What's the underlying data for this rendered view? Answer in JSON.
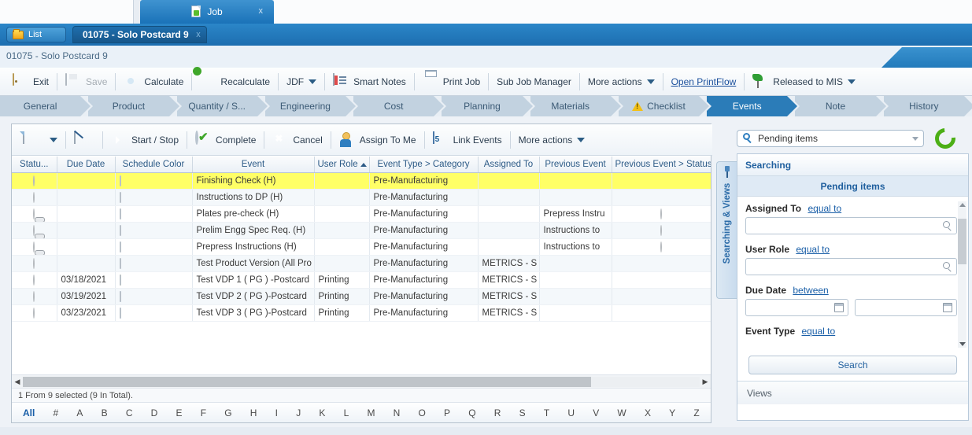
{
  "window": {
    "app_tab_label": "Job",
    "app_tab_close": "x",
    "app_tab_icon": "job-document-icon"
  },
  "header": {
    "list_button": "List",
    "record_tab": "01075 -   Solo Postcard 9",
    "record_tab_close": "x",
    "breadcrumb": "01075 - Solo Postcard 9"
  },
  "toolbar": {
    "items": [
      {
        "label": "Exit",
        "icon": "exit-door-icon",
        "disabled": false
      },
      {
        "label": "Save",
        "icon": "save-disk-icon",
        "disabled": true
      },
      {
        "label": "Calculate",
        "icon": "gear-icon",
        "disabled": false
      },
      {
        "label": "Recalculate",
        "icon": "gear-refresh-icon",
        "disabled": false
      },
      {
        "label": "JDF",
        "icon": "chevron-down-icon",
        "disabled": false
      },
      {
        "label": "Smart Notes",
        "icon": "smart-notes-icon",
        "disabled": false
      },
      {
        "label": "Print Job",
        "icon": "printer-icon",
        "disabled": false
      },
      {
        "label": "Sub Job Manager",
        "icon": "",
        "disabled": false
      },
      {
        "label": "More actions",
        "icon": "chevron-down-icon",
        "disabled": false
      },
      {
        "label": "Open PrintFlow",
        "icon": "",
        "disabled": false
      },
      {
        "label": "Released to MIS",
        "icon": "green-flag-icon",
        "disabled": false
      }
    ]
  },
  "ribbon": {
    "tabs": [
      {
        "label": "General",
        "active": false,
        "warn": false
      },
      {
        "label": "Product",
        "active": false,
        "warn": false
      },
      {
        "label": "Quantity / S...",
        "active": false,
        "warn": false
      },
      {
        "label": "Engineering",
        "active": false,
        "warn": false
      },
      {
        "label": "Cost",
        "active": false,
        "warn": false
      },
      {
        "label": "Planning",
        "active": false,
        "warn": false
      },
      {
        "label": "Materials",
        "active": false,
        "warn": false
      },
      {
        "label": "Checklist",
        "active": false,
        "warn": true
      },
      {
        "label": "Events",
        "active": true,
        "warn": false
      },
      {
        "label": "Note",
        "active": false,
        "warn": false
      },
      {
        "label": "History",
        "active": false,
        "warn": false
      }
    ]
  },
  "grid_toolbar": {
    "items": [
      {
        "label": "",
        "icon": "new-document-icon"
      },
      {
        "label": "",
        "icon": "chevron-down-icon"
      },
      {
        "label": "",
        "icon": "edit-document-icon"
      },
      {
        "label": "Start / Stop",
        "icon": "start-stop-icon"
      },
      {
        "label": "Complete",
        "icon": "check-circle-icon"
      },
      {
        "label": "Cancel",
        "icon": "cancel-circle-icon"
      },
      {
        "label": "Assign To Me",
        "icon": "user-icon"
      },
      {
        "label": "Link Events",
        "icon": "calendar-icon"
      },
      {
        "label": "More actions",
        "icon": "chevron-down-icon"
      }
    ]
  },
  "grid": {
    "columns": [
      {
        "label": "Statu...",
        "sorted": false
      },
      {
        "label": "Due Date",
        "sorted": false
      },
      {
        "label": "Schedule Color",
        "sorted": false
      },
      {
        "label": "Event",
        "sorted": false
      },
      {
        "label": "User Role",
        "sorted": true
      },
      {
        "label": "Event Type > Category",
        "sorted": false
      },
      {
        "label": "Assigned To",
        "sorted": false
      },
      {
        "label": "Previous Event",
        "sorted": false
      },
      {
        "label": "Previous Event > Status",
        "sorted": false
      }
    ],
    "rows": [
      {
        "status": "pending",
        "linked": false,
        "due_date": "",
        "color": "white",
        "event": "Finishing Check (H)",
        "user_role": "",
        "event_type": "Pre-Manufacturing",
        "assigned_to": "",
        "previous_event": "",
        "prev_status": "",
        "selected": true
      },
      {
        "status": "pending",
        "linked": false,
        "due_date": "",
        "color": "white",
        "event": "Instructions to DP (H)",
        "user_role": "",
        "event_type": "Pre-Manufacturing",
        "assigned_to": "",
        "previous_event": "",
        "prev_status": "",
        "selected": false
      },
      {
        "status": "pending",
        "linked": true,
        "due_date": "",
        "color": "white",
        "event": "Plates pre-check (H)",
        "user_role": "",
        "event_type": "Pre-Manufacturing",
        "assigned_to": "",
        "previous_event": "Prepress Instru",
        "prev_status": "pending",
        "selected": false
      },
      {
        "status": "pending",
        "linked": true,
        "due_date": "",
        "color": "white",
        "event": "Prelim Engg Spec Req. (H)",
        "user_role": "",
        "event_type": "Pre-Manufacturing",
        "assigned_to": "",
        "previous_event": "Instructions to",
        "prev_status": "pending",
        "selected": false
      },
      {
        "status": "pending",
        "linked": true,
        "due_date": "",
        "color": "white",
        "event": "Prepress Instructions (H)",
        "user_role": "",
        "event_type": "Pre-Manufacturing",
        "assigned_to": "",
        "previous_event": "Instructions to",
        "prev_status": "pending",
        "selected": false
      },
      {
        "status": "pending",
        "linked": false,
        "due_date": "",
        "color": "white",
        "event": "Test Product Version (All Pro",
        "user_role": "",
        "event_type": "Pre-Manufacturing",
        "assigned_to": "METRICS - S",
        "previous_event": "",
        "prev_status": "",
        "selected": false
      },
      {
        "status": "pending",
        "linked": false,
        "due_date": "03/18/2021",
        "color": "yellow",
        "event": "Test VDP 1 ( PG ) -Postcard",
        "user_role": "Printing",
        "event_type": "Pre-Manufacturing",
        "assigned_to": "METRICS - S",
        "previous_event": "",
        "prev_status": "",
        "selected": false
      },
      {
        "status": "pending",
        "linked": false,
        "due_date": "03/19/2021",
        "color": "blue",
        "event": "Test VDP 2 ( PG )-Postcard",
        "user_role": "Printing",
        "event_type": "Pre-Manufacturing",
        "assigned_to": "METRICS - S",
        "previous_event": "",
        "prev_status": "",
        "selected": false
      },
      {
        "status": "pending",
        "linked": false,
        "due_date": "03/23/2021",
        "color": "blue",
        "event": "Test VDP 3 ( PG  )-Postcard",
        "user_role": "Printing",
        "event_type": "Pre-Manufacturing",
        "assigned_to": "METRICS - S",
        "previous_event": "",
        "prev_status": "",
        "selected": false
      }
    ],
    "status_text": "1 From 9 selected (9 In Total).",
    "alphabet": [
      "All",
      "#",
      "A",
      "B",
      "C",
      "D",
      "E",
      "F",
      "G",
      "H",
      "I",
      "J",
      "K",
      "L",
      "M",
      "N",
      "O",
      "P",
      "Q",
      "R",
      "S",
      "T",
      "U",
      "V",
      "W",
      "X",
      "Y",
      "Z"
    ],
    "alphabet_selected": "All"
  },
  "side_panel": {
    "vertical_tab_label": "Searching & Views",
    "pin_icon": "pin-icon",
    "search_combo_value": "Pending items",
    "search_combo_icon": "search-icon",
    "refresh_icon": "refresh-icon",
    "section_title": "Searching",
    "subsection_title": "Pending items",
    "fields": [
      {
        "label": "Assigned To",
        "operator": "equal to",
        "value": "",
        "type": "lookup"
      },
      {
        "label": "User Role",
        "operator": "equal to",
        "value": "",
        "type": "lookup"
      },
      {
        "label": "Due Date",
        "operator": "between",
        "value": "",
        "value2": "",
        "type": "daterange"
      },
      {
        "label": "Event Type",
        "operator": "equal to",
        "value": "",
        "type": "lookup"
      }
    ],
    "search_button": "Search",
    "views_label": "Views"
  },
  "colors": {
    "accent_blue": "#1d6eb0",
    "selected_row": "#ffff66",
    "swatch_yellow": "#f7e08a",
    "swatch_blue": "#c4ddf5",
    "link": "#1a5fa8"
  }
}
